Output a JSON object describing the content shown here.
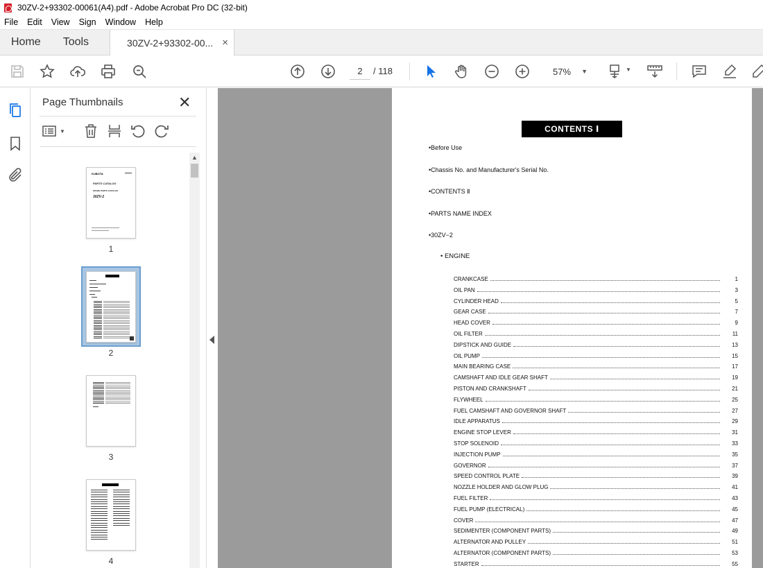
{
  "window": {
    "title": "30ZV-2+93302-00061(A4).pdf - Adobe Acrobat Pro DC (32-bit)"
  },
  "menu": [
    "File",
    "Edit",
    "View",
    "Sign",
    "Window",
    "Help"
  ],
  "tabs": {
    "home": "Home",
    "tools": "Tools",
    "document": "30ZV-2+93302-00...",
    "close_symbol": "×"
  },
  "toolbar": {
    "icons": [
      "save-icon",
      "star-icon",
      "upload-icon",
      "print-icon",
      "search-zoom-icon",
      "page-up-icon",
      "page-down-icon",
      "select-pointer-icon",
      "hand-icon",
      "zoom-out-icon",
      "zoom-in-icon",
      "fit-page-icon",
      "scroll-mode-icon",
      "comment-icon",
      "highlight-icon",
      "draw-icon"
    ],
    "current_page": "2",
    "page_total": "/ 118",
    "zoom": "57%",
    "accent_color": "#1473e6"
  },
  "thumbnails_panel": {
    "title": "Page Thumbnails",
    "close_symbol": "✕",
    "pages": [
      {
        "number": "1",
        "selected": false
      },
      {
        "number": "2",
        "selected": true
      },
      {
        "number": "3",
        "selected": false
      },
      {
        "number": "4",
        "selected": false
      }
    ]
  },
  "document": {
    "header": "CONTENTS Ⅰ",
    "top_entries": [
      "•Before Use",
      "•Chassis No. and Manufacturer's Serial No.",
      "•CONTENTS Ⅱ",
      "•PARTS NAME INDEX",
      "•30ZV−2"
    ],
    "section": "• ENGINE",
    "toc": [
      {
        "name": "CRANKCASE",
        "page": "1"
      },
      {
        "name": "OIL PAN",
        "page": "3"
      },
      {
        "name": "CYLINDER HEAD",
        "page": "5"
      },
      {
        "name": "GEAR CASE",
        "page": "7"
      },
      {
        "name": "HEAD COVER",
        "page": "9"
      },
      {
        "name": "OIL FILTER",
        "page": "11"
      },
      {
        "name": "DIPSTICK AND GUIDE",
        "page": "13"
      },
      {
        "name": "OIL PUMP",
        "page": "15"
      },
      {
        "name": "MAIN BEARING CASE",
        "page": "17"
      },
      {
        "name": "CAMSHAFT AND IDLE GEAR SHAFT",
        "page": "19"
      },
      {
        "name": "PISTON AND CRANKSHAFT",
        "page": "21"
      },
      {
        "name": "FLYWHEEL",
        "page": "25"
      },
      {
        "name": "FUEL CAMSHAFT AND GOVERNOR SHAFT",
        "page": "27"
      },
      {
        "name": "IDLE APPARATUS",
        "page": "29"
      },
      {
        "name": "ENGINE STOP LEVER",
        "page": "31"
      },
      {
        "name": "STOP SOLENOID",
        "page": "33"
      },
      {
        "name": "INJECTION PUMP",
        "page": "35"
      },
      {
        "name": "GOVERNOR",
        "page": "37"
      },
      {
        "name": "SPEED CONTROL PLATE",
        "page": "39"
      },
      {
        "name": "NOZZLE HOLDER AND GLOW PLUG",
        "page": "41"
      },
      {
        "name": "FUEL FILTER",
        "page": "43"
      },
      {
        "name": "FUEL PUMP (ELECTRICAL)",
        "page": "45"
      },
      {
        "name": "COVER",
        "page": "47"
      },
      {
        "name": "SEDIMENTER (COMPONENT PARTS)",
        "page": "49"
      },
      {
        "name": "ALTERNATOR AND PULLEY",
        "page": "51"
      },
      {
        "name": "ALTERNATOR (COMPONENT PARTS)",
        "page": "53"
      },
      {
        "name": "STARTER",
        "page": "55"
      }
    ]
  },
  "thumb1_text": {
    "brand": "KUBOTA",
    "line1": "PARTS CATALOG",
    "line2": "SPARE PARTS CATALOG",
    "model": "30ZV-2"
  }
}
